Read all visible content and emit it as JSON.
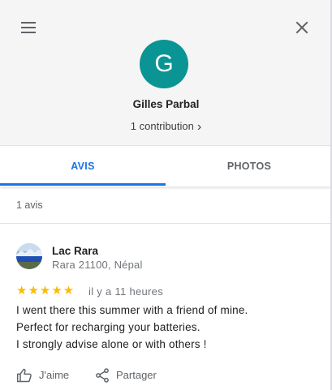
{
  "header": {
    "avatar_letter": "G",
    "avatar_color": "#0b9494",
    "name": "Gilles Parbal",
    "contributions": "1 contribution",
    "chevron": "›"
  },
  "tabs": [
    {
      "label": "AVIS",
      "active": true
    },
    {
      "label": "PHOTOS",
      "active": false
    }
  ],
  "reviews_count": "1 avis",
  "review": {
    "place_name": "Lac Rara",
    "place_address": "Rara 21100, Népal",
    "rating": 5,
    "stars": "★★★★★",
    "time": "il y a 11 heures",
    "lines": [
      "I went there this summer with a friend of mine.",
      "Perfect for recharging your batteries.",
      "I strongly advise alone or with others !"
    ]
  },
  "actions": {
    "like_label": "J'aime",
    "share_label": "Partager"
  },
  "icons": {
    "menu": "menu-icon",
    "close": "close-icon",
    "like": "thumb-up-icon",
    "share": "share-icon"
  },
  "colors": {
    "accent": "#1a73e8",
    "star": "#fbbc04",
    "header_bg": "#f5f5f5"
  }
}
